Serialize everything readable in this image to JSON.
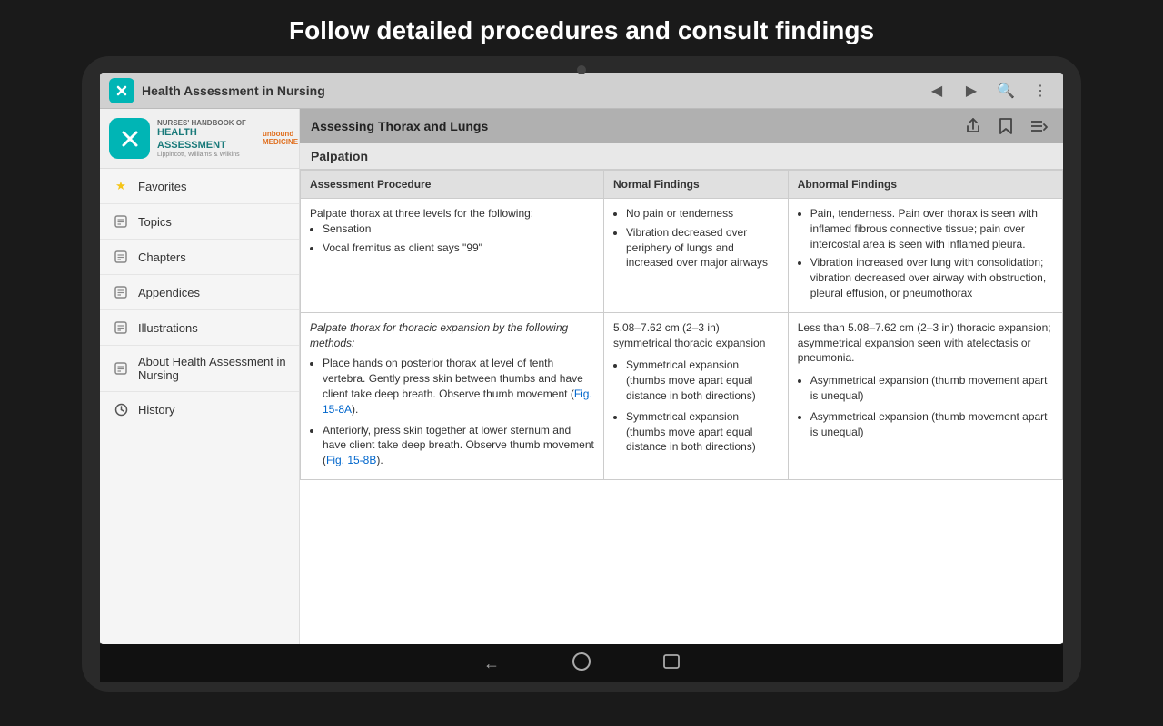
{
  "page": {
    "headline": "Follow detailed procedures and consult findings"
  },
  "topbar": {
    "app_title": "Health Assessment in Nursing",
    "back_icon": "◀",
    "forward_icon": "▶",
    "search_icon": "🔍",
    "menu_icon": "⋮"
  },
  "sidebar": {
    "publisher_prefix": "NURSES' HANDBOOK",
    "publisher_of": "of",
    "book_title": "HEALTH ASSESSMENT",
    "book_subtitle": "Lippincott, Williams & Wilkins",
    "items": [
      {
        "id": "favorites",
        "label": "Favorites",
        "icon": "★",
        "icon_type": "star"
      },
      {
        "id": "topics",
        "label": "Topics",
        "icon": "○",
        "icon_type": "circle"
      },
      {
        "id": "chapters",
        "label": "Chapters",
        "icon": "○",
        "icon_type": "circle"
      },
      {
        "id": "appendices",
        "label": "Appendices",
        "icon": "○",
        "icon_type": "circle"
      },
      {
        "id": "illustrations",
        "label": "Illustrations",
        "icon": "○",
        "icon_type": "circle"
      },
      {
        "id": "about",
        "label": "About Health Assessment in Nursing",
        "icon": "○",
        "icon_type": "circle"
      },
      {
        "id": "history",
        "label": "History",
        "icon": "🕐",
        "icon_type": "clock"
      }
    ]
  },
  "content": {
    "section_header": "Assessing Thorax and Lungs",
    "header_icons": {
      "share": "↩",
      "bookmark": "★",
      "toc": "≡↓"
    },
    "palpation_label": "Palpation",
    "table": {
      "headers": [
        "Assessment Procedure",
        "Normal Findings",
        "Abnormal Findings"
      ],
      "rows": [
        {
          "procedure": "Palpate thorax at three levels for the following:",
          "procedure_items": [
            "Sensation",
            "Vocal fremitus as client says \"99\""
          ],
          "normal": "",
          "normal_items": [
            "No pain or tenderness",
            "Vibration decreased over periphery of lungs and increased over major airways"
          ],
          "abnormal": "",
          "abnormal_items": [
            "Pain, tenderness. Pain over thorax is seen with inflamed fibrous connective tissue; pain over intercostal area is seen with inflamed pleura.",
            "Vibration increased over lung with consolidation; vibration decreased over airway with obstruction, pleural effusion, or pneumothorax"
          ]
        },
        {
          "procedure_italic": "Palpate thorax for thoracic expansion by the following methods:",
          "procedure_items": [
            "Place hands on posterior thorax at level of tenth vertebra. Gently press skin between thumbs and have client take deep breath. Observe thumb movement (Fig. 15-8A).",
            "Anteriorly, press skin together at lower sternum and have client take deep breath. Observe thumb movement (Fig. 15-8B)."
          ],
          "normal": "5.08–7.62 cm (2–3 in) symmetrical thoracic expansion",
          "normal_items": [
            "Symmetrical expansion (thumbs move apart equal distance in both directions)",
            "Symmetrical expansion (thumbs move apart equal distance in both directions)"
          ],
          "abnormal": "Less than 5.08–7.62 cm (2–3 in) thoracic expansion; asymmetrical expansion seen with atelectasis or pneumonia.",
          "abnormal_items": [
            "Asymmetrical expansion (thumb movement apart is unequal)",
            "Asymmetrical expansion (thumb movement apart is unequal)"
          ]
        }
      ]
    }
  },
  "android_nav": {
    "back": "←",
    "home": "○",
    "recents": "□"
  }
}
